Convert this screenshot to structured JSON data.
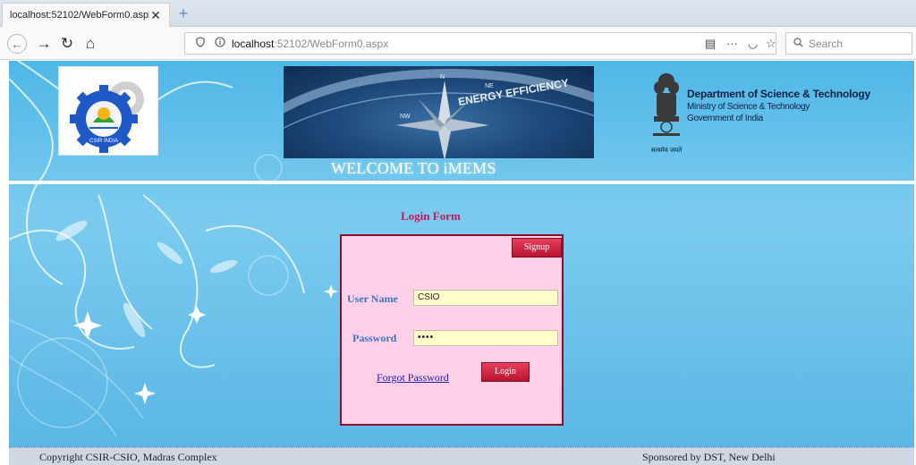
{
  "browser": {
    "tab_title": "localhost:52102/WebForm0.aspx",
    "tab_close": "✕",
    "new_tab": "+",
    "url_host": "localhost",
    "url_path": ":52102/WebForm0.aspx",
    "search_placeholder": "Search",
    "nav": {
      "back": "←",
      "forward": "→",
      "reload": "↻",
      "home": "⌂"
    },
    "toolbar": {
      "reader": "▤",
      "more": "···",
      "pocket": "◡",
      "bookmark": "☆"
    }
  },
  "header": {
    "welcome_text": "WELCOME  TO iMEMS",
    "dept_name": "Department of Science & Technology",
    "ministry": "Ministry of Science & Technology",
    "government": "Government of India",
    "emblem_motto": "सत्यमेव जयते",
    "banner_text": "ENERGY EFFICIENCY",
    "banner_directions": [
      "NW",
      "N",
      "NE"
    ],
    "logo_text": "CSIR INDIA"
  },
  "login": {
    "title": "Login Form",
    "signup_label": "Signup",
    "username_label": "User Name",
    "username_value": "CSIO",
    "password_label": "Password",
    "password_value": "••••",
    "forgot_label": "Forgot Password",
    "login_label": "Login"
  },
  "footer": {
    "copyright": "Copyright CSIR-CSIO, Madras Complex",
    "sponsor": "Sponsored by  DST, New Delhi"
  },
  "colors": {
    "background_blue": "#5ab7e4",
    "form_bg": "#ffd0e8",
    "form_border": "#8d0f2c",
    "button_red": "#c81d3a",
    "field_bg": "#ffffc9",
    "label_blue": "#3f76c0",
    "title_red": "#c0185a"
  }
}
